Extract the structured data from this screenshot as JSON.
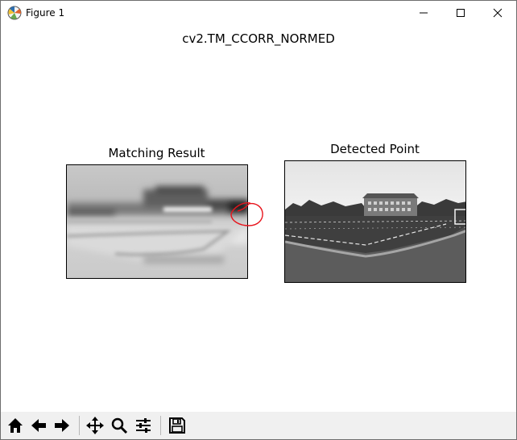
{
  "window": {
    "title": "Figure 1"
  },
  "figure": {
    "suptitle": "cv2.TM_CCORR_NORMED",
    "left_axes": {
      "title": "Matching Result"
    },
    "right_axes": {
      "title": "Detected Point"
    }
  },
  "toolbar": {
    "buttons": [
      "home-icon",
      "back-icon",
      "forward-icon",
      "pan-icon",
      "zoom-icon",
      "configure-subplots-icon",
      "save-icon"
    ]
  },
  "colors": {
    "annotation": "#e8141c",
    "toolbar_bg": "#f0f0f0"
  }
}
